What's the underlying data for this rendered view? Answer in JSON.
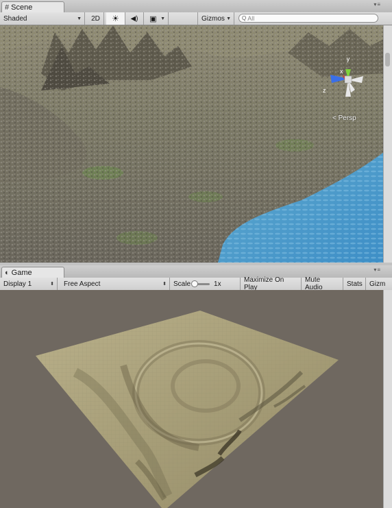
{
  "scene": {
    "tab_label": "Scene",
    "tab_icon": "#",
    "shading_mode": "Shaded",
    "btn_2d": "2D",
    "lighting_icon": "☀",
    "audio_icon": "◀)",
    "effects_icon": "▣",
    "gizmos_label": "Gizmos",
    "search_placeholder": "All",
    "search_icon": "Q",
    "projection_label": "Persp",
    "axis_y": "y",
    "axis_x": "x",
    "axis_z": "z",
    "colors": {
      "axis_y": "#7ed53a",
      "axis_x": "#e0302b",
      "axis_z": "#3a6fe8",
      "water": "#4aa7d6"
    }
  },
  "game": {
    "tab_label": "Game",
    "tab_icon": "◐",
    "display": "Display 1",
    "aspect": "Free Aspect",
    "scale_label": "Scale",
    "scale_value": "1x",
    "maximize_on_play": "Maximize On Play",
    "mute_audio": "Mute Audio",
    "stats": "Stats",
    "gizmos": "Gizm"
  },
  "window_menu_icon": "▾≡"
}
